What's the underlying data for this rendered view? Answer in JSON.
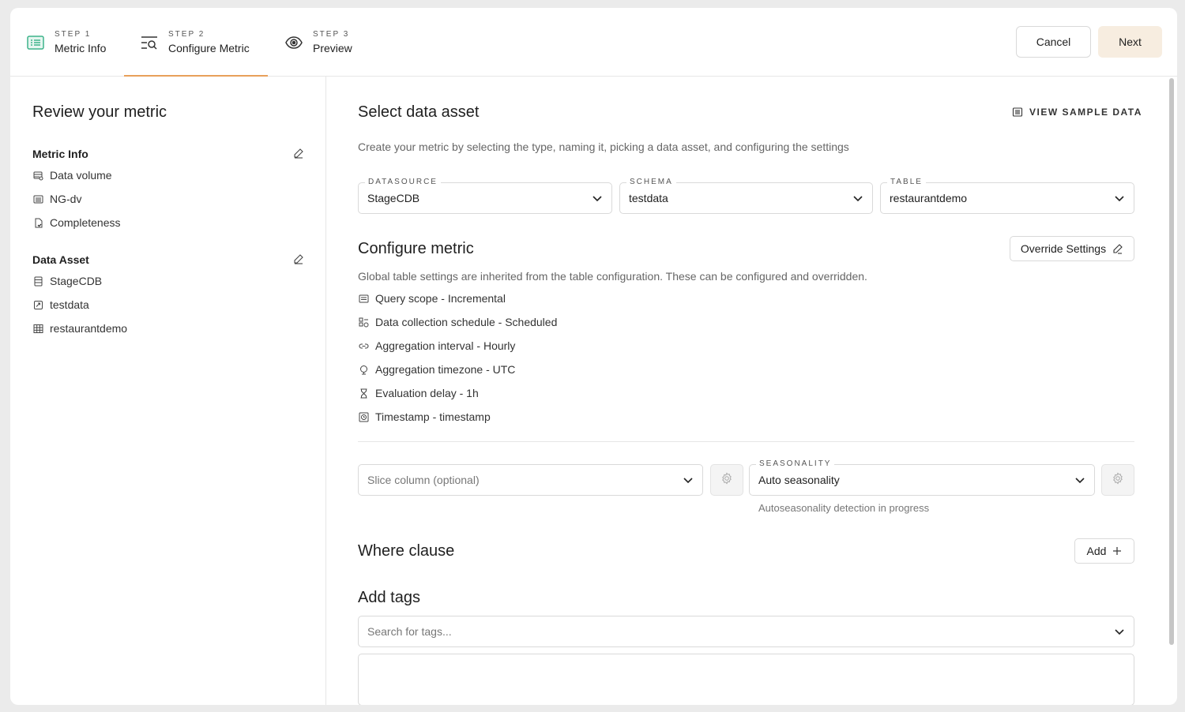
{
  "steps": [
    {
      "label": "STEP 1",
      "name": "Metric Info",
      "icon": "list-card-icon"
    },
    {
      "label": "STEP 2",
      "name": "Configure Metric",
      "icon": "filter-search-icon"
    },
    {
      "label": "STEP 3",
      "name": "Preview",
      "icon": "eye-icon"
    }
  ],
  "actions": {
    "cancel": "Cancel",
    "next": "Next"
  },
  "accent_color": "#e8a05a",
  "review": {
    "title": "Review your metric",
    "metric_info": {
      "heading": "Metric Info",
      "items": [
        {
          "label": "Data volume",
          "icon": "database-icon"
        },
        {
          "label": "NG-dv",
          "icon": "list-icon"
        },
        {
          "label": "Completeness",
          "icon": "file-check-icon"
        }
      ]
    },
    "data_asset": {
      "heading": "Data Asset",
      "items": [
        {
          "label": "StageCDB",
          "icon": "server-icon"
        },
        {
          "label": "testdata",
          "icon": "schema-icon"
        },
        {
          "label": "restaurantdemo",
          "icon": "table-icon"
        }
      ]
    }
  },
  "select_asset": {
    "title": "Select data asset",
    "view_sample": "VIEW SAMPLE DATA",
    "description": "Create your metric by selecting the type, naming it, picking a data asset, and configuring the settings",
    "datasource": {
      "label": "DATASOURCE",
      "value": "StageCDB"
    },
    "schema": {
      "label": "SCHEMA",
      "value": "testdata"
    },
    "table": {
      "label": "TABLE",
      "value": "restaurantdemo"
    }
  },
  "configure": {
    "title": "Configure metric",
    "override": "Override Settings",
    "description": "Global table settings are inherited from the table configuration. These can be configured and overridden.",
    "settings": [
      {
        "label": "Query scope - Incremental",
        "icon": "scope-icon"
      },
      {
        "label": "Data collection schedule - Scheduled",
        "icon": "schedule-icon"
      },
      {
        "label": "Aggregation interval - Hourly",
        "icon": "link-icon"
      },
      {
        "label": "Aggregation timezone - UTC",
        "icon": "globe-icon"
      },
      {
        "label": "Evaluation delay - 1h",
        "icon": "hourglass-icon"
      },
      {
        "label": "Timestamp - timestamp",
        "icon": "timestamp-icon"
      }
    ],
    "slice_placeholder": "Slice column (optional)",
    "seasonality": {
      "label": "SEASONALITY",
      "value": "Auto seasonality",
      "hint": "Autoseasonality detection in progress"
    }
  },
  "where_clause": {
    "title": "Where clause",
    "add": "Add"
  },
  "tags": {
    "title": "Add tags",
    "placeholder": "Search for tags..."
  }
}
